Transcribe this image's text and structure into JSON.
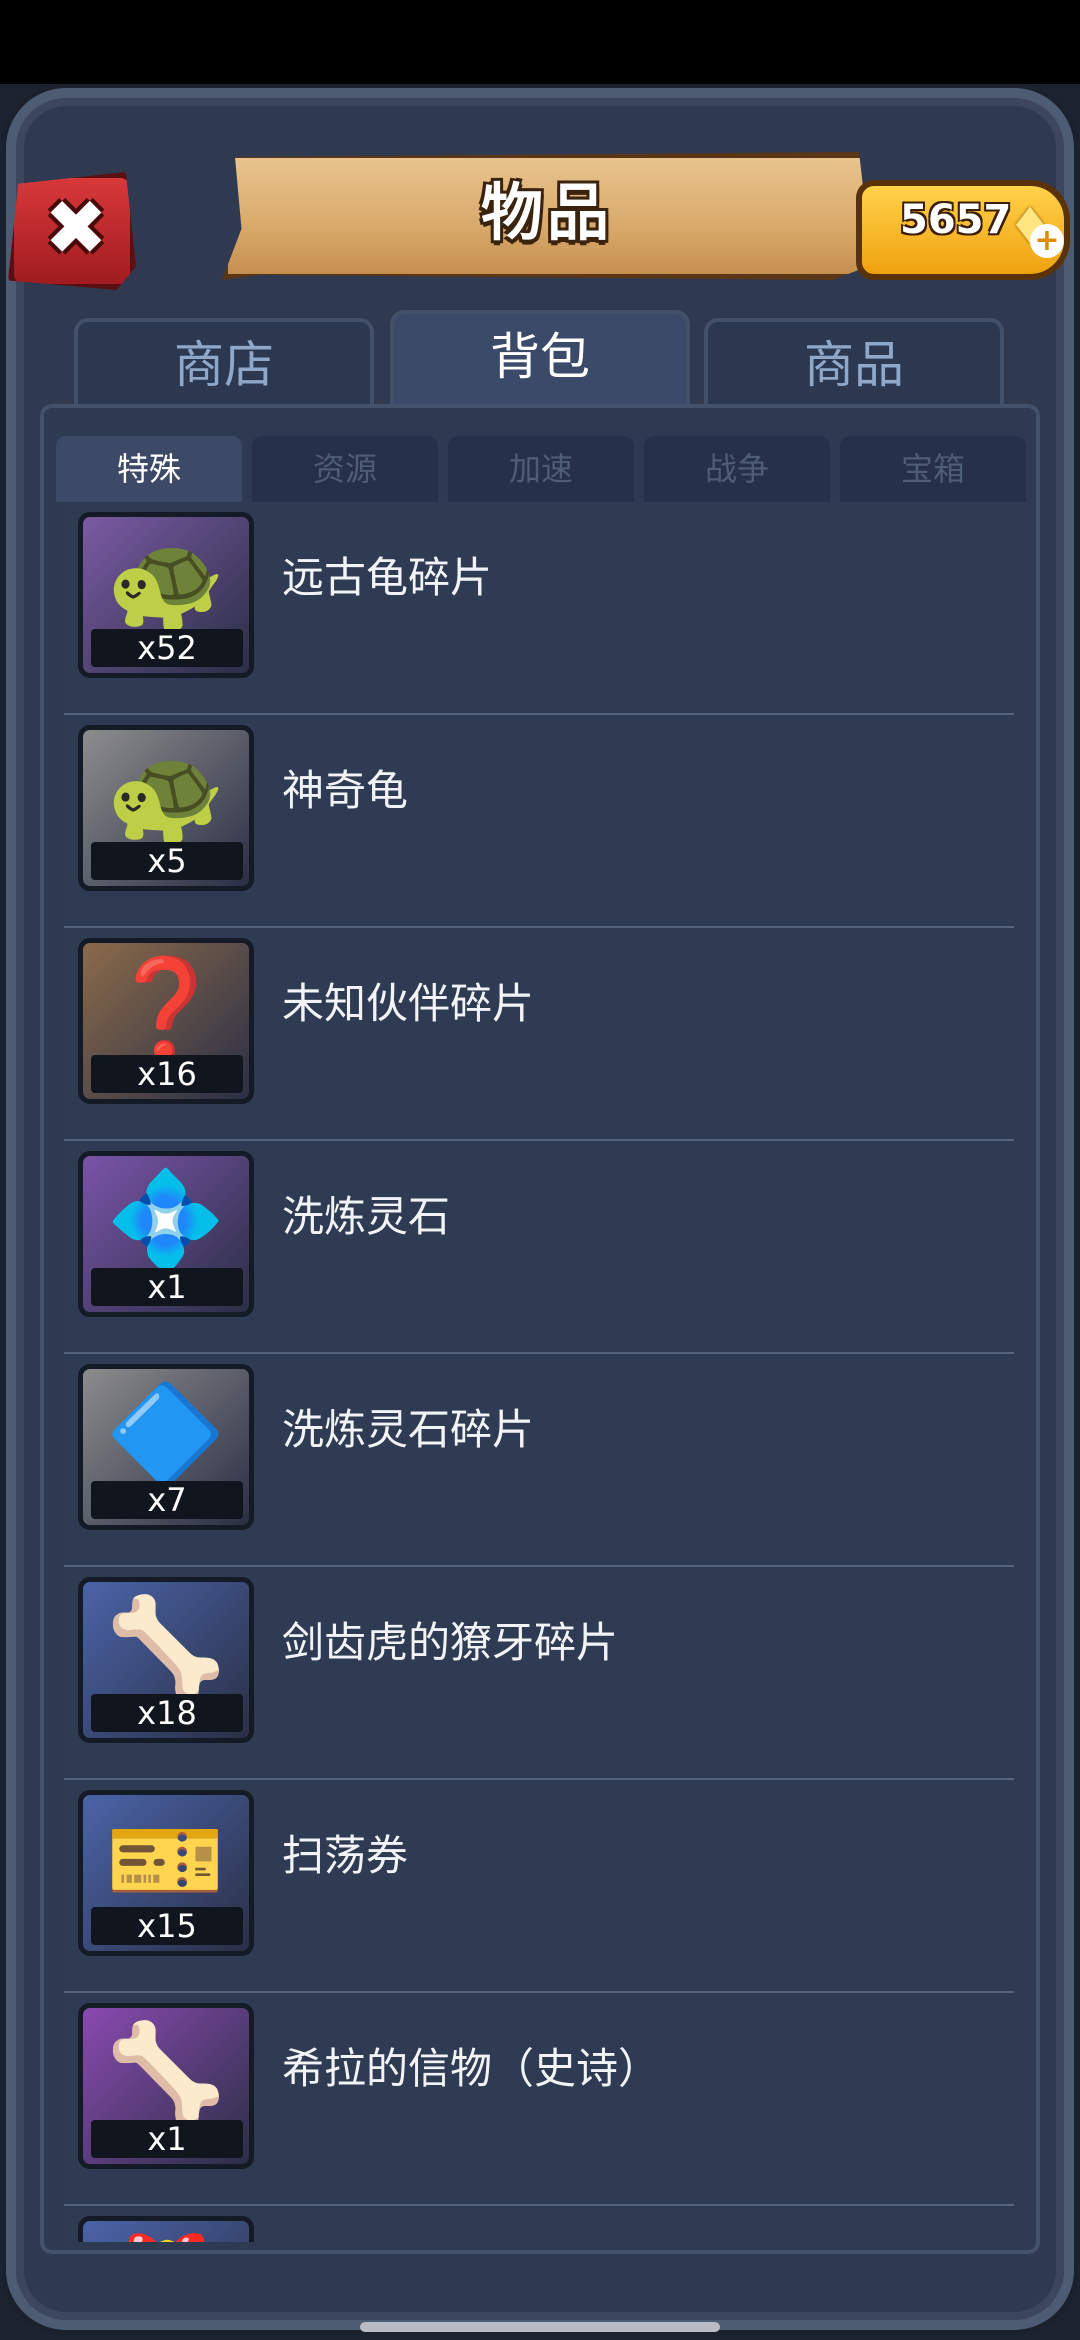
{
  "header": {
    "title": "物品",
    "gem_count": "5657",
    "close_icon": "close-icon",
    "gem_icon": "gem-icon",
    "plus_icon": "plus-icon"
  },
  "main_tabs": [
    {
      "label": "商店",
      "active": false
    },
    {
      "label": "背包",
      "active": true
    },
    {
      "label": "商品",
      "active": false
    }
  ],
  "sub_tabs": [
    {
      "label": "特殊",
      "active": true
    },
    {
      "label": "资源",
      "active": false
    },
    {
      "label": "加速",
      "active": false
    },
    {
      "label": "战争",
      "active": false
    },
    {
      "label": "宝箱",
      "active": false
    }
  ],
  "items": [
    {
      "name": "远古龟碎片",
      "qty": "x52",
      "icon": "turtle-fragment-icon",
      "glyph": "🐢",
      "bg": "#7a5aa3"
    },
    {
      "name": "神奇龟",
      "qty": "x5",
      "icon": "turtle-icon",
      "glyph": "🐢",
      "bg": "#8d8d8d"
    },
    {
      "name": "未知伙伴碎片",
      "qty": "x16",
      "icon": "mystery-fragment-icon",
      "glyph": "❓",
      "bg": "#8a6a4a"
    },
    {
      "name": "洗炼灵石",
      "qty": "x1",
      "icon": "spirit-stone-icon",
      "glyph": "💠",
      "bg": "#7a54a8"
    },
    {
      "name": "洗炼灵石碎片",
      "qty": "x7",
      "icon": "spirit-stone-fragment-icon",
      "glyph": "🔷",
      "bg": "#8c8c8c"
    },
    {
      "name": "剑齿虎的獠牙碎片",
      "qty": "x18",
      "icon": "tusk-fragment-icon",
      "glyph": "🦴",
      "bg": "#4a64a8"
    },
    {
      "name": "扫荡券",
      "qty": "x15",
      "icon": "sweep-ticket-icon",
      "glyph": "🎫",
      "bg": "#4a64a8"
    },
    {
      "name": "希拉的信物（史诗）",
      "qty": "x1",
      "icon": "token-icon",
      "glyph": "🦴",
      "bg": "#8a4ab0"
    },
    {
      "name": "",
      "qty": "",
      "icon": "partial-item-icon",
      "glyph": "🎁",
      "bg": "#4a64a8"
    }
  ],
  "colors": {
    "background": "#1b2230",
    "panel": "#2e3a52",
    "banner": "#d8a96a",
    "close_button": "#c32a2e",
    "gem_pill": "#f4b01f"
  }
}
